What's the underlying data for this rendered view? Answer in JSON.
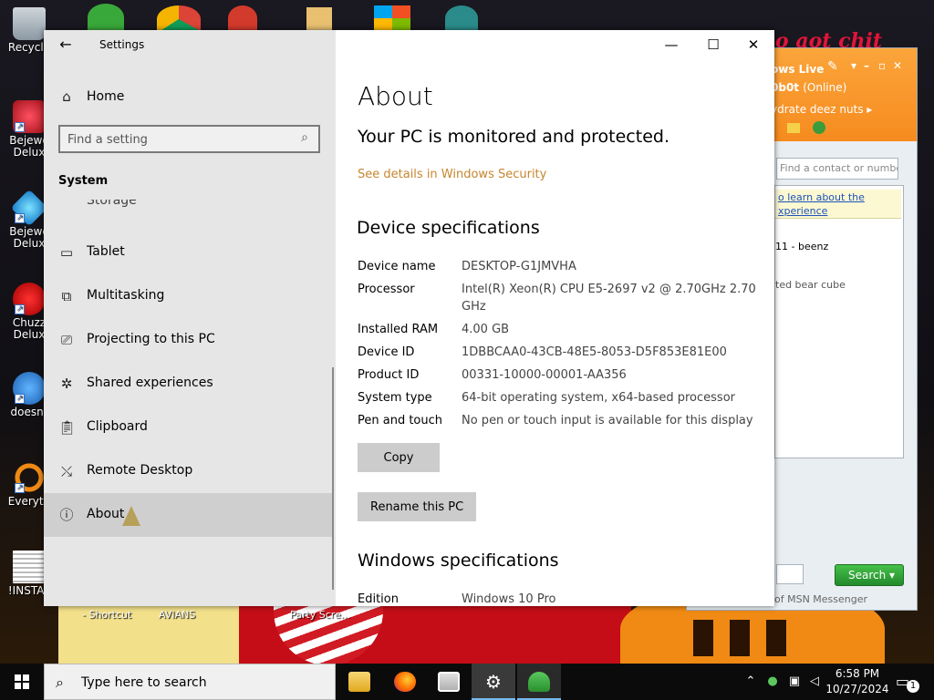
{
  "desktop": {
    "icons": [
      {
        "label": "Recycle"
      },
      {
        "label": "Bejewe Delux"
      },
      {
        "label": "Bejewe Delux"
      },
      {
        "label": "Chuzz Delux"
      },
      {
        "label": "doesnt"
      },
      {
        "label": "Everyth"
      },
      {
        "label": "!INSTAL"
      }
    ],
    "bottom_labels": [
      "- Shortcut",
      "AVIANS",
      "Party Scre..."
    ],
    "wallpaper_text": "o aot chit"
  },
  "msn": {
    "title": "ows Live",
    "user": "0b0t",
    "status": "(Online)",
    "personal_message": "ydrate deez nuts",
    "search_placeholder": "Find a contact or numbe",
    "info_line1": "o learn about the",
    "info_line2": "xperience",
    "contact1": "11 - beenz",
    "contact2": "ted bear cube",
    "search_button": "Search",
    "footer": "of MSN Messenger"
  },
  "settings": {
    "app_title": "Settings",
    "nav": {
      "home": "Home",
      "search_placeholder": "Find a setting",
      "section": "System",
      "partial_item": "Storage",
      "items": [
        {
          "label": "Tablet"
        },
        {
          "label": "Multitasking"
        },
        {
          "label": "Projecting to this PC"
        },
        {
          "label": "Shared experiences"
        },
        {
          "label": "Clipboard"
        },
        {
          "label": "Remote Desktop"
        },
        {
          "label": "About"
        }
      ]
    },
    "content": {
      "title": "About",
      "protection_message": "Your PC is monitored and protected.",
      "security_link": "See details in Windows Security",
      "device_specs_heading": "Device specifications",
      "device_specs": [
        {
          "label": "Device name",
          "value": "DESKTOP-G1JMVHA"
        },
        {
          "label": "Processor",
          "value": "Intel(R) Xeon(R) CPU E5-2697 v2 @ 2.70GHz   2.70 GHz"
        },
        {
          "label": "Installed RAM",
          "value": "4.00 GB"
        },
        {
          "label": "Device ID",
          "value": "1DBBCAA0-43CB-48E5-8053-D5F853E81E00"
        },
        {
          "label": "Product ID",
          "value": "00331-10000-00001-AA356"
        },
        {
          "label": "System type",
          "value": "64-bit operating system, x64-based processor"
        },
        {
          "label": "Pen and touch",
          "value": "No pen or touch input is available for this display"
        }
      ],
      "copy_button": "Copy",
      "rename_button": "Rename this PC",
      "windows_specs_heading": "Windows specifications",
      "windows_specs": [
        {
          "label": "Edition",
          "value": "Windows 10 Pro"
        }
      ]
    }
  },
  "taskbar": {
    "search_text": "Type here to search",
    "time": "6:58 PM",
    "date": "10/27/2024",
    "notification_count": "1"
  },
  "colors": {
    "accent_link": "#c5862e",
    "nav_bg": "#e6e6e6",
    "selected_nav": "#cfcfcf",
    "msn_orange": "#f68b1f"
  }
}
